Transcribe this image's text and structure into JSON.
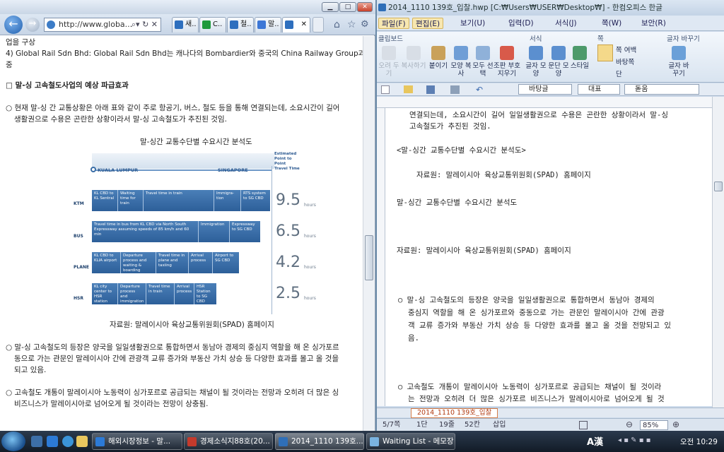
{
  "ie": {
    "address": "http://www.globa...",
    "tabs": [
      "새..",
      "C..",
      "철..",
      "말..",
      ""
    ],
    "content": {
      "line1": "업을 구상",
      "line2": "4) Global Rail Sdn Bhd: Global Rail Sdn Bhd는 캐나다의 Bombardier와 중국의 China Railway Group과",
      "line3": "중",
      "heading": "□ 말-싱 고속철도사업의 예상 파급효과",
      "para1a": "○ 현재 말-싱 간 교통상황은 아래 표와 같이 주로 항공기, 버스, 철도 등을 통해 연결되는데, 소요시간이 길어",
      "para1b": "생활권으로 수용은 곤란한 상황이라서 말-싱 고속철도가 추진된 것임.",
      "fig_title": "말-싱간 교통수단별 수요시간 분석도",
      "source": "자료원: 말레이시아 육상교통위원회(SPAD) 홈페이지",
      "para2a": "○ 말-싱 고속철도의 등장은 양국을 일일생활권으로 통합하면서 동남아 경제의 중심지 역할을 해 온 싱가포르",
      "para2b": "동으로 가는 관문인 말레이시아 간에 관광객 교류 증가와 부동산 가치 상승 등 다양한 효과를 몰고 올 것을",
      "para2c": "되고 있음.",
      "para3a": "○ 고속철도 개통이 말레이시아 노동력이 싱가포르로 공급되는 채널이 될 것이라는 전망과 오히려 더 많은 싱",
      "para3b": "비즈니스가 말레이시아로 넘어오게 될 것이라는 전망이 상충됨."
    },
    "infographic": {
      "kl": "KUALA LUMPUR",
      "sg": "SINGAPORE",
      "estimated": "Estimated Point to Point Travel Time",
      "hours_label": "hours",
      "rows": [
        {
          "mode": "KTM",
          "hours": "9.5",
          "segs": [
            "KL CBD to KL Sentral",
            "Waiting time for train",
            "Travel time in train",
            "Immigra-tion",
            "RTS system to SG CBD"
          ]
        },
        {
          "mode": "BUS",
          "hours": "6.5",
          "segs": [
            "Travel time in bus from KL CBD via North South Expressway assuming speeds of 85 km/h and 60 min",
            "Immigration",
            "Expressway to SG CBD"
          ]
        },
        {
          "mode": "PLANE",
          "hours": "4.2",
          "segs": [
            "KL CBD to KLIA airport",
            "Departure process and waiting & boarding",
            "Travel time in plane and taxiing",
            "Arrival process",
            "Airport to SG CBD"
          ]
        },
        {
          "mode": "HSR",
          "hours": "2.5",
          "segs": [
            "KL city center to HSR station",
            "Departure process and immigration",
            "Travel time in train",
            "Arrival process",
            "HSR Station to SG CBD"
          ]
        }
      ]
    }
  },
  "hw": {
    "title": "2014_1110 139호_입찰.hwp [C:₩Users₩USER₩Desktop₩] - 한컴오피스 한글",
    "menus": [
      "파일(F)",
      "편집(E)",
      "보기(U)",
      "입력(D)",
      "서식(J)",
      "쪽(W)",
      "보안(R)"
    ],
    "ribbon": {
      "clipboard": "클립보드",
      "format": "서식",
      "page": "쪽",
      "replace": "글자 바꾸기",
      "buttons": [
        "오려 두기",
        "복사하기",
        "붙이기",
        "모양 복사",
        "모두 선택",
        "조판 부호 지우기",
        "글자 모양",
        "문단 모양",
        "스타일",
        "쪽 여백",
        "바탕쪽",
        "단",
        "글자 바꾸기"
      ]
    },
    "toolbar": {
      "style": "바탕글",
      "font_type": "대표",
      "font": "돋움"
    },
    "doc": {
      "l1": "연결되는데, 소요시간이 길어 일일생활권으로 수용은 곤란한 상황이라서 말-싱",
      "l2": "고속철도가 추진된 것임.",
      "l3": "<말-싱간 교통수단별 수요시간 분석도>",
      "l4": "자료원: 말레이시아 육상교통위원회(SPAD) 홈페이지",
      "l5": "말-싱간 교통수단별 수요시간 분석도",
      "l6": "자료원: 말레이시아 육상교통위원회(SPAD) 홈페이지",
      "l7": "○ 말-싱 고속철도의 등장은 양국을 일일생활권으로 통합하면서 동남아 경제의",
      "l8": "중심지 역할을 해 온 싱가포르와 중동으로 가는 관문인 말레이시아 간에 관광",
      "l9": "객 교류 증가와 부동산 가치 상승 등 다양한 효과를 몰고 올 것을 전망되고 있",
      "l10": "음.",
      "l11": "○ 고속철도 개통이 말레이시아 노동력이 싱가포르로 공급되는 채널이 될 것이라",
      "l12": "는 전망과 오히려 더 많은 싱가포르 비즈니스가 말레이시아로 넘어오게 될 것"
    },
    "doc_tab": "2014_1110 139호_입찰",
    "status": {
      "page": "5/7쪽",
      "section": "1단",
      "line": "19줄",
      "col": "52칸",
      "mode": "삽입",
      "zoom": "85%"
    }
  },
  "taskbar": {
    "items": [
      "해외시장정보 - 말...",
      "경제소식지88호(20...",
      "2014_1110 139호...",
      "Waiting List - 메모장"
    ],
    "ime": "A漢",
    "clock": "오전 10:29"
  }
}
